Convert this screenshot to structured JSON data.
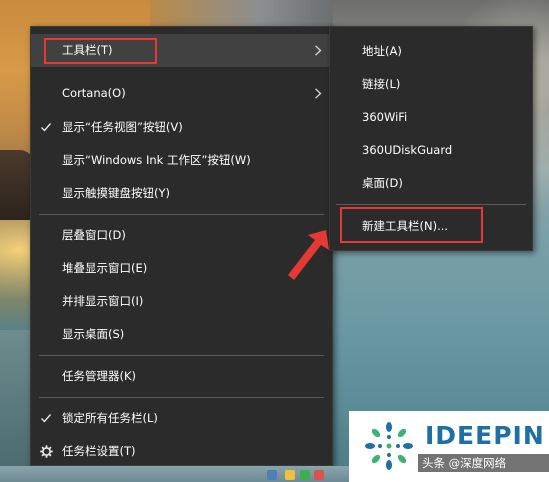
{
  "main_menu": {
    "items": [
      {
        "label": "工具栏(T)"
      },
      {
        "label": "Cortana(O)"
      },
      {
        "label": "显示“任务视图”按钮(V)"
      },
      {
        "label": "显示“Windows Ink 工作区”按钮(W)"
      },
      {
        "label": "显示触摸键盘按钮(Y)"
      },
      {
        "label": "层叠窗口(D)"
      },
      {
        "label": "堆叠显示窗口(E)"
      },
      {
        "label": "并排显示窗口(I)"
      },
      {
        "label": "显示桌面(S)"
      },
      {
        "label": "任务管理器(K)"
      },
      {
        "label": "锁定所有任务栏(L)"
      },
      {
        "label": "任务栏设置(T)"
      }
    ]
  },
  "toolbar_submenu": {
    "items": [
      {
        "label": "地址(A)"
      },
      {
        "label": "链接(L)"
      },
      {
        "label": "360WiFi"
      },
      {
        "label": "360UDiskGuard"
      },
      {
        "label": "桌面(D)"
      },
      {
        "label": "新建工具栏(N)..."
      }
    ]
  },
  "watermark": {
    "brand": "IDEEPIN",
    "caption": "头条 @深度网络"
  },
  "colors": {
    "menu_background": "#2b2b2b",
    "menu_hover": "#414141",
    "highlight_red": "#e53935",
    "brand_blue": "#1d6fa5"
  }
}
